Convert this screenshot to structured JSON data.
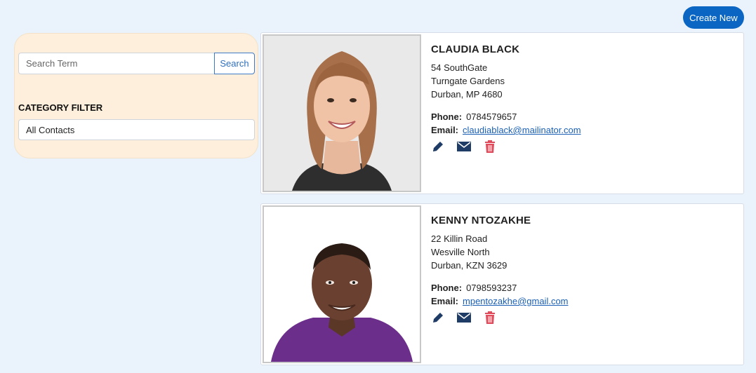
{
  "header": {
    "create_label": "Create New"
  },
  "sidebar": {
    "search_placeholder": "Search Term",
    "search_button": "Search",
    "category_label": "CATEGORY FILTER",
    "category_selected": "All Contacts"
  },
  "contacts": [
    {
      "name": "CLAUDIA BLACK",
      "address1": "54 SouthGate",
      "address2": "Turngate Gardens",
      "address3": "Durban, MP 4680",
      "phone_label": "Phone:",
      "phone": "0784579657",
      "email_label": "Email:",
      "email": "claudiablack@mailinator.com"
    },
    {
      "name": "KENNY NTOZAKHE",
      "address1": "22 Killin Road",
      "address2": "Wesville North",
      "address3": "Durban, KZN 3629",
      "phone_label": "Phone:",
      "phone": "0798593237",
      "email_label": "Email:",
      "email": "mpentozakhe@gmail.com"
    }
  ],
  "colors": {
    "accent": "#0a66c2",
    "sidebar_bg": "#fdefdb",
    "page_bg": "#eaf2fb",
    "icon": "#1f3c66",
    "delete": "#e04a5a"
  },
  "icons": [
    "pencil-icon",
    "envelope-icon",
    "trash-icon"
  ]
}
